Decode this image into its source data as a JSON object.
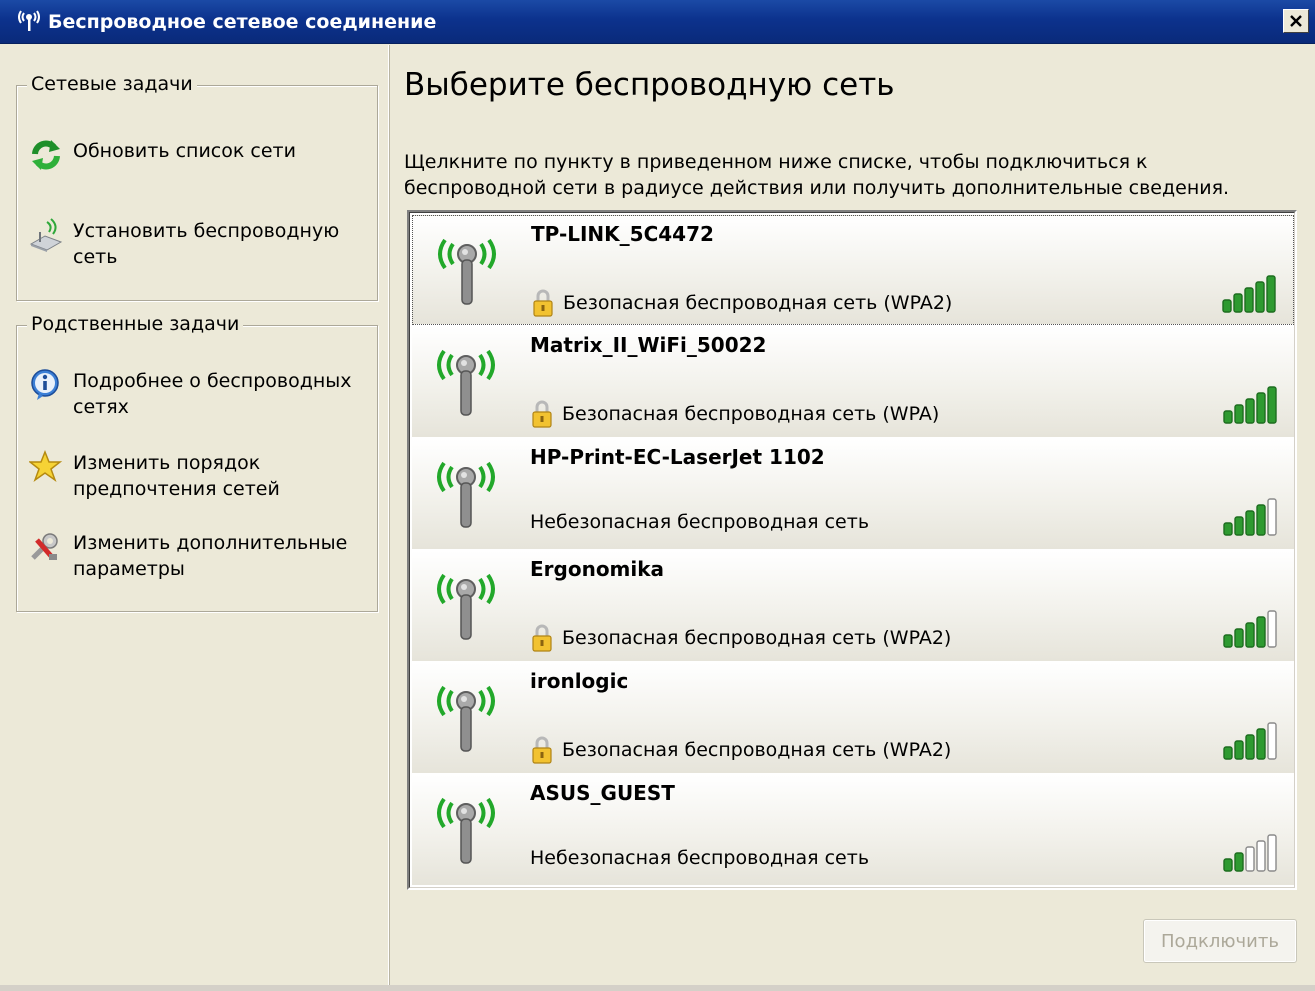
{
  "window": {
    "title": "Беспроводное сетевое соединение",
    "title_icon": "wireless-network-icon",
    "close_icon": "close-icon"
  },
  "sidebar": {
    "network_tasks": {
      "title": "Сетевые задачи",
      "items": [
        {
          "label": "Обновить список сети",
          "icon": "refresh-icon"
        },
        {
          "label": "Установить беспроводную\nсеть",
          "icon": "wireless-setup-icon"
        }
      ]
    },
    "related_tasks": {
      "title": "Родственные задачи",
      "items": [
        {
          "label": "Подробнее о беспроводных\nсетях",
          "icon": "info-icon"
        },
        {
          "label": "Изменить порядок\nпредпочтения  сетей",
          "icon": "star-icon"
        },
        {
          "label": "Изменить дополнительные\nпараметры",
          "icon": "settings-icon"
        }
      ]
    }
  },
  "main": {
    "heading": "Выберите беспроводную сеть",
    "instructions": "Щелкните по пункту в приведенном ниже списке, чтобы подключиться к беспроводной сети в радиусе действия или получить дополнительные сведения.",
    "networks": [
      {
        "name": "TP-LINK_5C4472",
        "security": "Безопасная беспроводная сеть (WPA2)",
        "secured": true,
        "signal_bars": 5,
        "selected": true
      },
      {
        "name": "Matrix_II_WiFi_50022",
        "security": "Безопасная беспроводная сеть (WPA)",
        "secured": true,
        "signal_bars": 5,
        "selected": false
      },
      {
        "name": "HP-Print-EC-LaserJet 1102",
        "security": "Небезопасная беспроводная сеть",
        "secured": false,
        "signal_bars": 4,
        "selected": false
      },
      {
        "name": "Ergonomika",
        "security": "Безопасная беспроводная сеть (WPA2)",
        "secured": true,
        "signal_bars": 4,
        "selected": false
      },
      {
        "name": "ironlogic",
        "security": "Безопасная беспроводная сеть (WPA2)",
        "secured": true,
        "signal_bars": 4,
        "selected": false
      },
      {
        "name": "ASUS_GUEST",
        "security": "Небезопасная беспроводная сеть",
        "secured": false,
        "signal_bars": 2,
        "selected": false
      }
    ],
    "connect_label": "Подключить"
  },
  "colors": {
    "title_bar": "#0c328d",
    "antenna_green": "#22a82a",
    "signal_green": "#2e9a30",
    "lock_yellow": "#f2c230"
  }
}
